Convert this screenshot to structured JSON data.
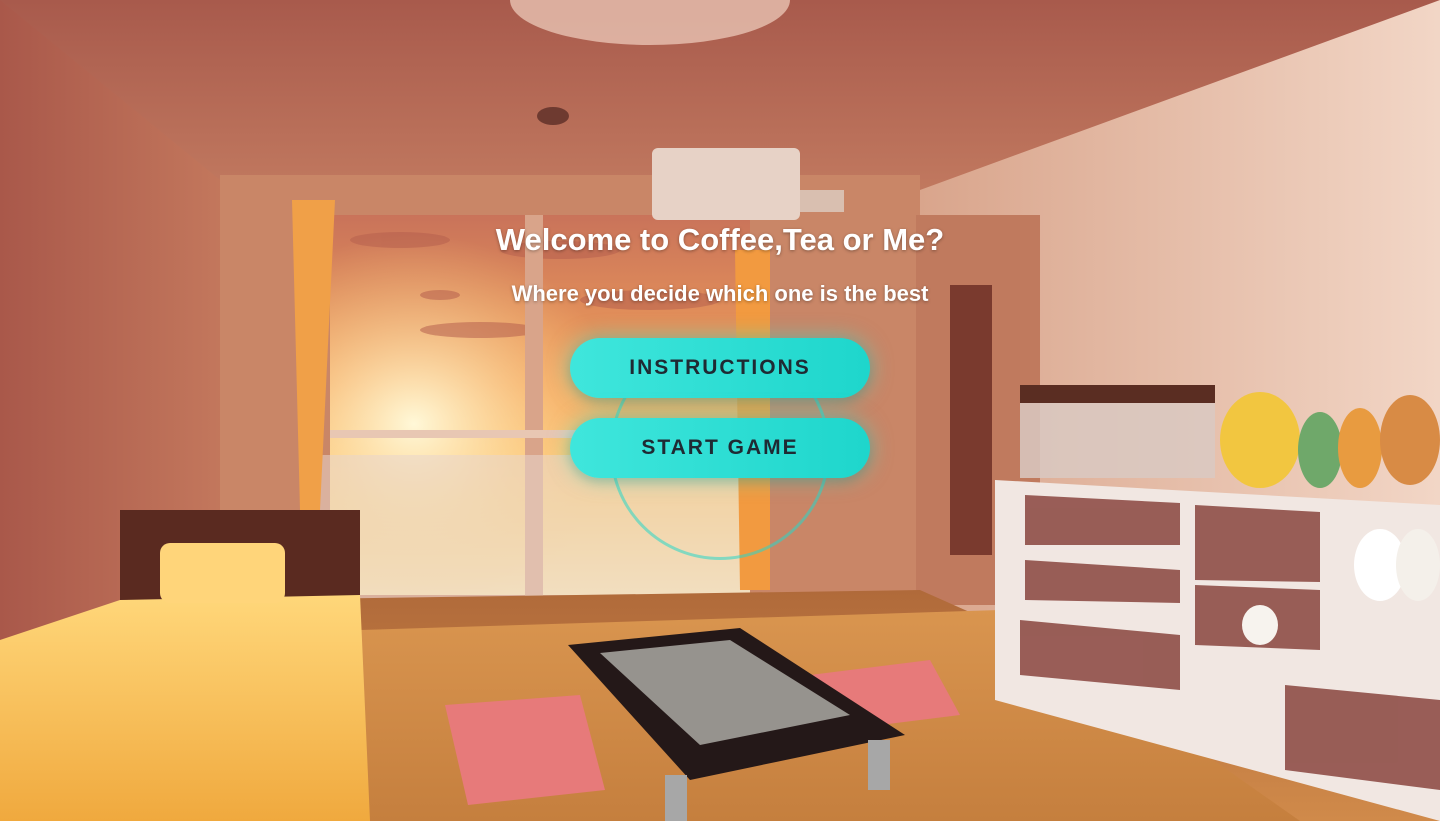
{
  "screen": {
    "title": "Welcome to Coffee,Tea or Me?",
    "subtitle": "Where you decide which one is the best"
  },
  "menu": {
    "instructions_label": "INSTRUCTIONS",
    "start_label": "START GAME"
  },
  "colors": {
    "button_accent": "#2ee0d6",
    "button_text": "#1f2a33",
    "heading_text": "#ffffff"
  },
  "background": {
    "description_icon": "anime-bedroom-sunset-background"
  }
}
